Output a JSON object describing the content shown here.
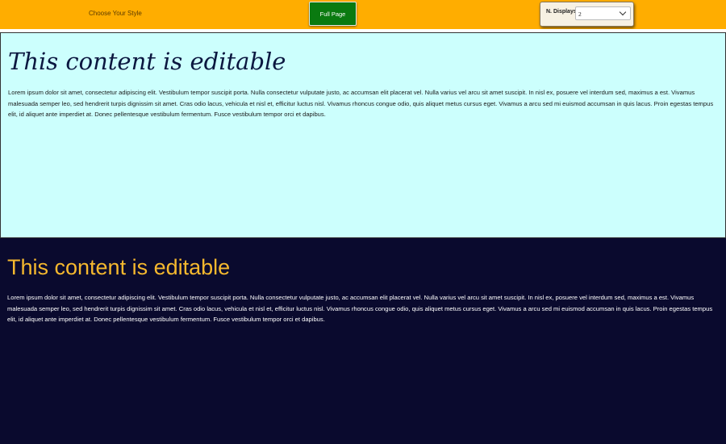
{
  "toolbar": {
    "style_label": "Choose Your Style",
    "full_page_label": "Full Page",
    "displays_label": "N. Displays",
    "displays_value": "2"
  },
  "light_panel": {
    "heading": "This content is editable",
    "body": "Lorem ipsum dolor sit amet, consectetur adipiscing elit. Vestibulum tempor suscipit porta. Nulla consectetur vulputate justo, ac accumsan elit placerat vel. Nulla varius vel arcu sit amet suscipit. In nisl ex, posuere vel interdum sed, maximus a est. Vivamus malesuada semper leo, sed hendrerit turpis dignissim sit amet. Cras odio lacus, vehicula et nisl et, efficitur luctus nisl. Vivamus rhoncus congue odio, quis aliquet metus cursus eget. Vivamus a arcu sed mi euismod accumsan in quis lacus. Proin egestas tempus elit, id aliquet ante imperdiet at. Donec pellentesque vestibulum fermentum. Fusce vestibulum tempor orci et dapibus."
  },
  "dark_panel": {
    "heading": "This content is editable",
    "body": "Lorem ipsum dolor sit amet, consectetur adipiscing elit. Vestibulum tempor suscipit porta. Nulla consectetur vulputate justo, ac accumsan elit placerat vel. Nulla varius vel arcu sit amet suscipit. In nisl ex, posuere vel interdum sed, maximus a est. Vivamus malesuada semper leo, sed hendrerit turpis dignissim sit amet. Cras odio lacus, vehicula et nisl et, efficitur luctus nisl. Vivamus rhoncus congue odio, quis aliquet metus cursus eget. Vivamus a arcu sed mi euismod accumsan in quis lacus. Proin egestas tempus elit, id aliquet ante imperdiet at. Donec pellentesque vestibulum fermentum. Fusce vestibulum tempor orci et dapibus."
  },
  "colors": {
    "toolbar_bg": "#ffad00",
    "button_green": "#0a7a10",
    "light_panel_bg": "#ccfffd",
    "dark_panel_bg": "#0a0a2e",
    "dark_heading": "#f5b82e"
  },
  "icons": {
    "select_arrow": "chevron-down-icon"
  }
}
